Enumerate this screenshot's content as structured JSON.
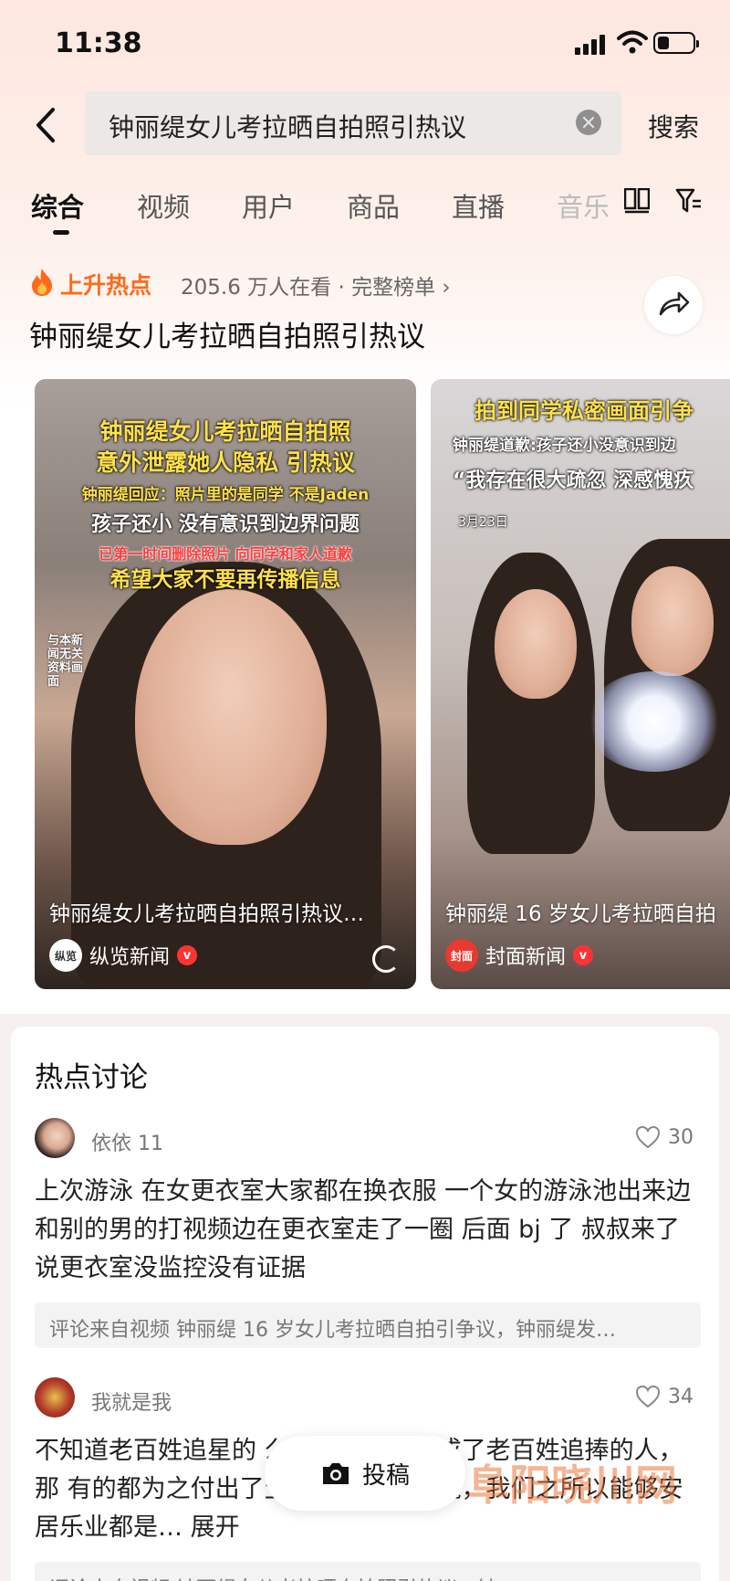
{
  "status_bar": {
    "time": "11:38"
  },
  "search": {
    "query": "钟丽缇女儿考拉晒自拍照引热议",
    "button_label": "搜索"
  },
  "tabs": [
    "综合",
    "视频",
    "用户",
    "商品",
    "直播",
    "音乐"
  ],
  "active_tab": "综合",
  "hot": {
    "tag": "上升热点",
    "meta": "205.6 万人在看 · 完整榜单 ›",
    "title": "钟丽缇女儿考拉晒自拍照引热议"
  },
  "videos": [
    {
      "overlay_lines": [
        "钟丽缇女儿考拉晒自拍照",
        "意外泄露她人隐私 引热议",
        "钟丽缇回应：照片里的是同学 不是Jaden",
        "孩子还小 没有意识到边界问题",
        "已第一时间删除照片 向同学和家人道歉",
        "希望大家不要再传播信息"
      ],
      "side_note": "与本新闻无关资料画面",
      "caption": "钟丽缇女儿考拉晒自拍照引热议…",
      "source": "纵览新闻",
      "source_logo": "纵览"
    },
    {
      "overlay_lines": [
        "拍到同学私密画面引争",
        "钟丽缇道歉:孩子还小没意识到边",
        "“我存在很大疏忽 深感愧疚",
        "3月23日"
      ],
      "caption": "钟丽缇 16 岁女儿考拉晒自拍",
      "source": "封面新闻",
      "source_logo": "封面"
    }
  ],
  "discussion": {
    "title": "热点讨论",
    "comments": [
      {
        "user": "依依 11",
        "likes": "30",
        "text": "上次游泳 在女更衣室大家都在换衣服 一个女的游泳池出来边和别的男的打视频边在更衣室走了一圈 后面 bj 了 叔叔来了说更衣室没监控没有证据",
        "ref": "评论来自视频  钟丽缇 16 岁女儿考拉晒自拍引争议，钟丽缇发…"
      },
      {
        "user": "我就是我",
        "likes": "34",
        "text": "不知道老百姓追星的                    么时候这些明星成了老百姓追捧的人，那                    有的都为之付出了生命，确无人知晓，我们之所以能够安居乐业都是… 展开",
        "ref": "评论来自视频  钟丽缇女儿考拉晒自拍照引热议，钟…"
      }
    ]
  },
  "post_button": "投稿",
  "watermark": "阜阳晓川网",
  "colors": {
    "accent_orange": "#ff6a1a",
    "verify_red": "#ff3333",
    "background_pink": "#fde7df"
  }
}
